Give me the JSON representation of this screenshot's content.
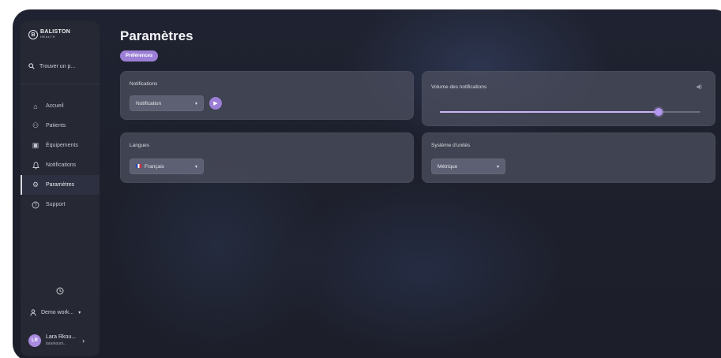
{
  "app": {
    "logo_line1": "BALISTON",
    "logo_line2": "HEALTH",
    "logo_mark": "B"
  },
  "sidebar": {
    "search_placeholder": "Trouver un p...",
    "items": [
      {
        "label": "Accueil",
        "icon": "home-icon",
        "glyph": "⌂"
      },
      {
        "label": "Patients",
        "icon": "users-icon",
        "glyph": "⚇"
      },
      {
        "label": "Équipements",
        "icon": "briefcase-icon",
        "glyph": "▣"
      },
      {
        "label": "Notifications",
        "icon": "bell-icon",
        "glyph": "♫"
      },
      {
        "label": "Paramètres",
        "icon": "gear-icon",
        "glyph": "⚙",
        "active": true
      },
      {
        "label": "Support",
        "icon": "help-icon",
        "glyph": "?"
      }
    ],
    "workspace_label": "Demo work...",
    "user": {
      "initials": "LR",
      "name": "Lara Rkou...",
      "email": "lararkouni..."
    }
  },
  "page": {
    "title": "Paramètres",
    "tab": "Préférences"
  },
  "cards": {
    "notifications": {
      "title": "Notifications",
      "select_value": "Notification"
    },
    "volume": {
      "title": "Volume des notifications",
      "level": 0.84
    },
    "languages": {
      "title": "Langues",
      "select_value": "Français"
    },
    "units": {
      "title": "Système d'unités",
      "select_value": "Métrique"
    }
  },
  "colors": {
    "accent": "#9b7fd6",
    "sidebar_bg": "#262833",
    "card_bg": "#4e5060",
    "background": "#1f2230"
  }
}
